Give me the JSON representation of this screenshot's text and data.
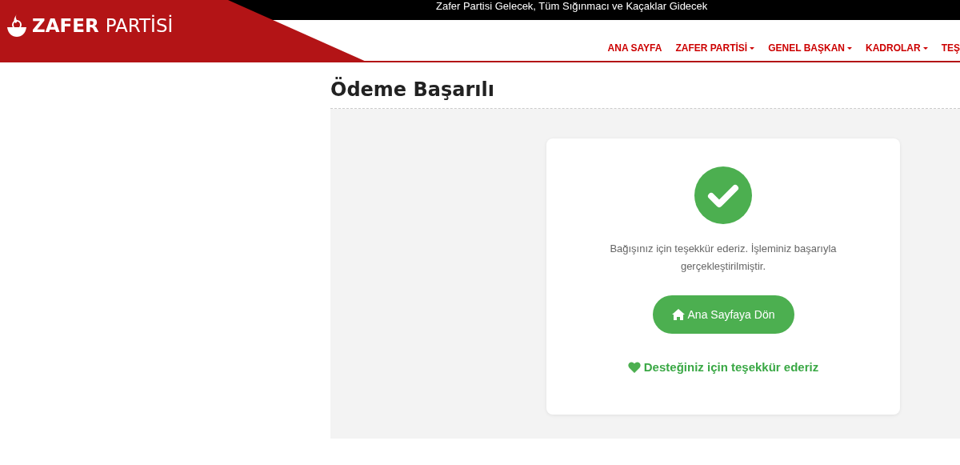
{
  "top_bar": {
    "slogan": "Zafer Partisi Gelecek, Tüm Sığınmacı ve Kaçaklar Gidecek"
  },
  "logo": {
    "bold": "ZAFER",
    "light": "PARTİSİ"
  },
  "nav": [
    {
      "label": "ANA SAYFA",
      "dropdown": false
    },
    {
      "label": "ZAFER PARTİSİ",
      "dropdown": true
    },
    {
      "label": "GENEL BAŞKAN",
      "dropdown": true
    },
    {
      "label": "KADROLAR",
      "dropdown": true
    },
    {
      "label": "TEŞ",
      "dropdown": false
    }
  ],
  "page": {
    "title": "Ödeme Başarılı"
  },
  "card": {
    "message": "Bağışınız için teşekkür ederiz. İşleminiz başarıyla gerçekleştirilmiştir.",
    "button": "Ana Sayfaya Dön",
    "thanks": "Desteğiniz için teşekkür ederiz"
  }
}
